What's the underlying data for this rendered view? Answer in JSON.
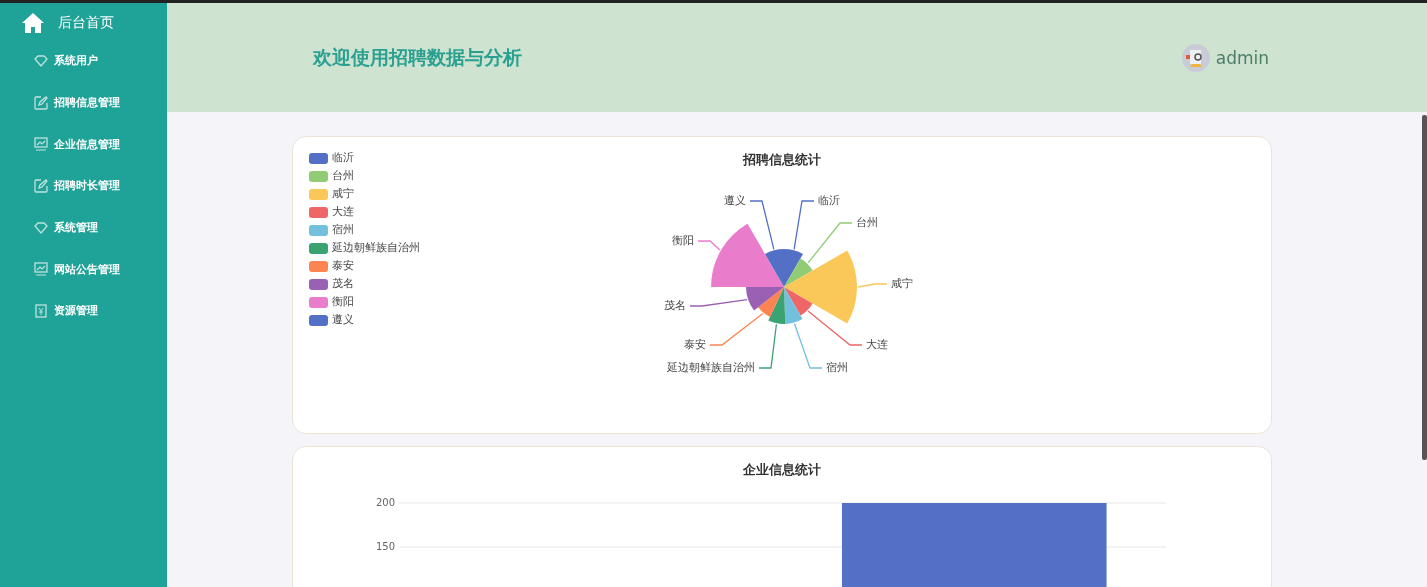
{
  "sidebar": {
    "items": [
      {
        "label": "后台首页",
        "kind": "home"
      },
      {
        "label": "系统用户",
        "kind": "diamond"
      },
      {
        "label": "招聘信息管理",
        "kind": "edit"
      },
      {
        "label": "企业信息管理",
        "kind": "monitor"
      },
      {
        "label": "招聘时长管理",
        "kind": "edit"
      },
      {
        "label": "系统管理",
        "kind": "diamond"
      },
      {
        "label": "网站公告管理",
        "kind": "monitor"
      },
      {
        "label": "资源管理",
        "kind": "doc"
      }
    ]
  },
  "header": {
    "title": "欢迎使用招聘数据与分析",
    "user": "admin"
  },
  "rose_chart": {
    "title": "招聘信息统计",
    "legend": [
      {
        "label": "临沂",
        "color": "#5470c6"
      },
      {
        "label": "台州",
        "color": "#91cc75"
      },
      {
        "label": "咸宁",
        "color": "#fac858"
      },
      {
        "label": "大连",
        "color": "#ee6666"
      },
      {
        "label": "宿州",
        "color": "#73c0de"
      },
      {
        "label": "延边朝鲜族自治州",
        "color": "#3ba272"
      },
      {
        "label": "泰安",
        "color": "#fc8452"
      },
      {
        "label": "茂名",
        "color": "#9a60b4"
      },
      {
        "label": "衡阳",
        "color": "#ea7ccc"
      },
      {
        "label": "遵义",
        "color": "#5470c6"
      }
    ],
    "slices": [
      {
        "label": "临沂",
        "color": "#5470c6"
      },
      {
        "label": "台州",
        "color": "#91cc75"
      },
      {
        "label": "咸宁",
        "color": "#fac858"
      },
      {
        "label": "大连",
        "color": "#ee6666"
      },
      {
        "label": "宿州",
        "color": "#73c0de"
      },
      {
        "label": "延边朝鲜族自治州",
        "color": "#3ba272"
      },
      {
        "label": "泰安",
        "color": "#fc8452"
      },
      {
        "label": "茂名",
        "color": "#9a60b4"
      },
      {
        "label": "衡阳",
        "color": "#ea7ccc"
      },
      {
        "label": "遵义",
        "color": "#5470c6"
      }
    ]
  },
  "bar_chart": {
    "chart_data": {
      "type": "bar",
      "title": "企业信息统计",
      "ylim": [
        0,
        200
      ],
      "yticks": [
        150,
        200
      ],
      "series": [
        {
          "color": "#5470c6",
          "values": [
            null,
            200
          ]
        }
      ]
    }
  }
}
